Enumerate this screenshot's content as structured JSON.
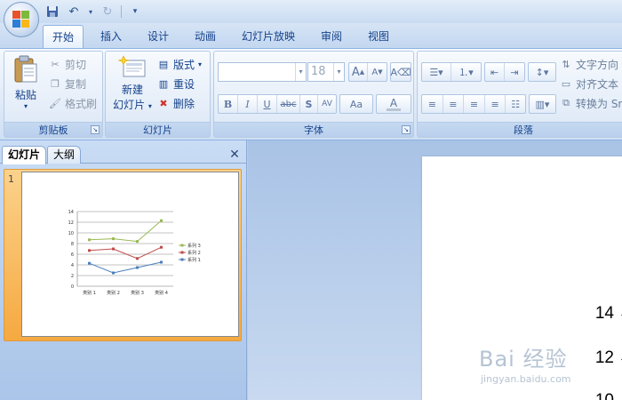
{
  "tabs": [
    {
      "label": "开始",
      "active": true
    },
    {
      "label": "插入"
    },
    {
      "label": "设计"
    },
    {
      "label": "动画"
    },
    {
      "label": "幻灯片放映"
    },
    {
      "label": "审阅"
    },
    {
      "label": "视图"
    }
  ],
  "ribbon": {
    "clipboard": {
      "title": "剪贴板",
      "paste_label": "粘贴",
      "cut_label": "剪切",
      "copy_label": "复制",
      "format_painter_label": "格式刷"
    },
    "slides": {
      "title": "幻灯片",
      "new_slide_line1": "新建",
      "new_slide_line2": "幻灯片",
      "layout_label": "版式",
      "reset_label": "重设",
      "delete_label": "删除"
    },
    "font": {
      "title": "字体",
      "font_name": "",
      "font_size": "18",
      "bold": "B",
      "italic": "I",
      "underline": "U",
      "strike": "abc",
      "shadow": "S",
      "spacing": "AV",
      "case": "Aa",
      "grow": "A",
      "shrink": "A"
    },
    "paragraph": {
      "title": "段落",
      "text_direction_label": "文字方向",
      "align_text_label": "对齐文本",
      "convert_label": "转换为 Sm"
    }
  },
  "panel": {
    "tab_slides": "幻灯片",
    "tab_outline": "大纲",
    "close": "✕",
    "slide_number": "1"
  },
  "thumbnail_chart": {
    "type": "line",
    "categories": [
      "类别 1",
      "类别 2",
      "类别 3",
      "类别 4"
    ],
    "series": [
      {
        "name": "系列 1",
        "values": [
          4.3,
          2.5,
          3.5,
          4.5
        ],
        "color": "#4a7ebb"
      },
      {
        "name": "系列 2",
        "values": [
          6.7,
          7.0,
          5.2,
          7.3
        ],
        "color": "#be4b48"
      },
      {
        "name": "系列 3",
        "values": [
          8.7,
          8.9,
          8.4,
          12.3
        ],
        "color": "#98b954"
      }
    ],
    "ylim": [
      0,
      14
    ],
    "yticks": [
      "0",
      "2",
      "4",
      "6",
      "8",
      "10",
      "12",
      "14"
    ]
  },
  "slide_axis_ticks": [
    "14",
    "12",
    "10"
  ],
  "watermark": {
    "logo": "Bai 经验",
    "url": "jingyan.baidu.com"
  }
}
